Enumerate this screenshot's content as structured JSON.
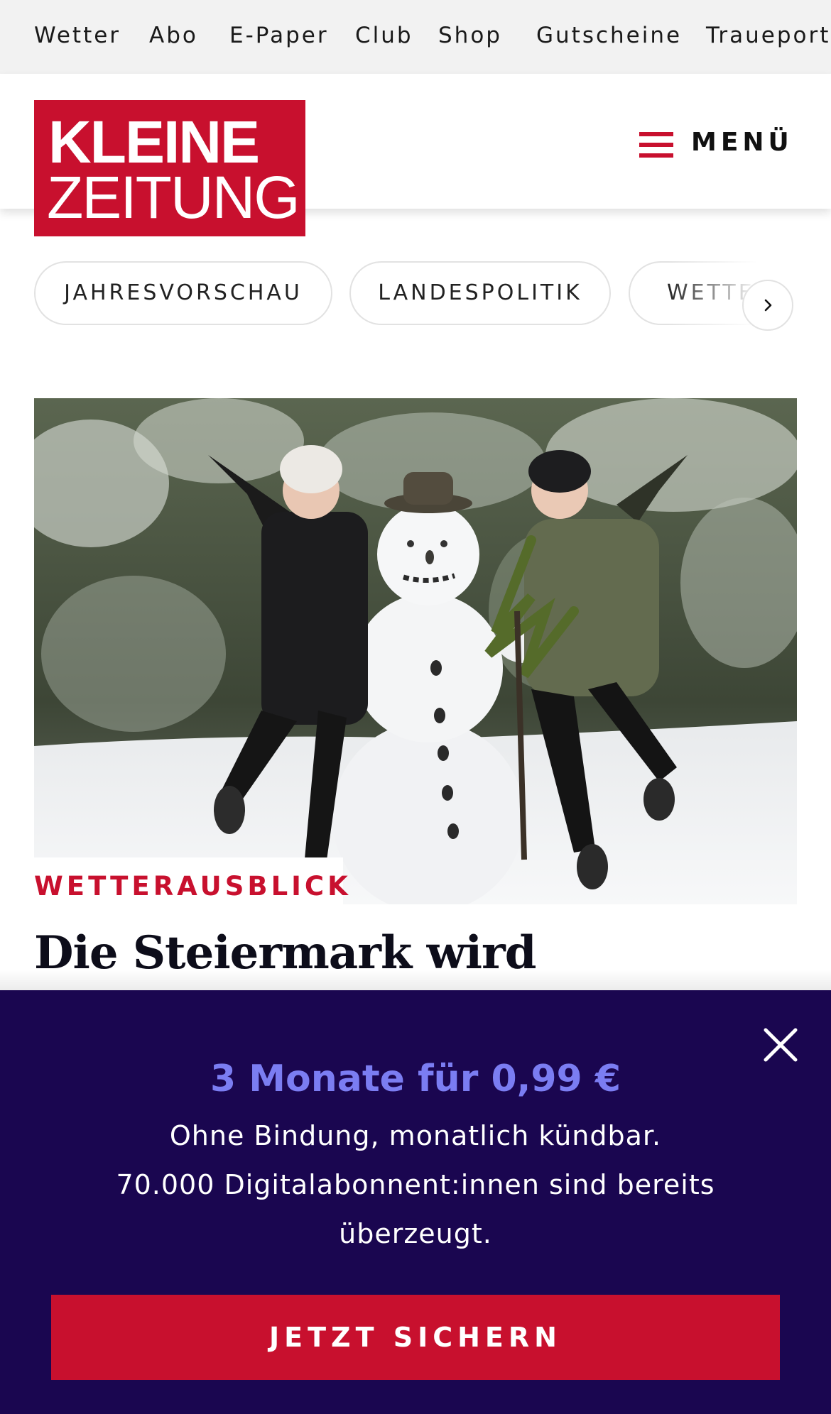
{
  "topnav": {
    "items": [
      {
        "label": "Wetter"
      },
      {
        "label": "Abo"
      },
      {
        "label": "E-Paper"
      },
      {
        "label": "Club"
      },
      {
        "label": "Shop"
      },
      {
        "label": "Gutscheine"
      },
      {
        "label": "Traueportal"
      }
    ]
  },
  "header": {
    "logo_line1": "KLEINE",
    "logo_line2": "ZEITUNG",
    "menu_label": "MENÜ",
    "brand_color": "#c8102e"
  },
  "pills": {
    "items": [
      {
        "label": "JAHRESVORSCHAU"
      },
      {
        "label": "LANDESPOLITIK"
      },
      {
        "label": "WETTER"
      }
    ],
    "next_icon": "chevron-right-icon"
  },
  "article": {
    "kicker": "WETTERAUSBLICK",
    "headline": "Die Steiermark wird",
    "image": "snowman-photo"
  },
  "promo": {
    "title": "3 Monate für 0,99 €",
    "line1": "Ohne Bindung, monatlich kündbar.",
    "line2": "70.000 Digitalabonnent:innen sind bereits",
    "line3": "überzeugt.",
    "cta_label": "JETZT SICHERN",
    "close_icon": "close-icon",
    "background_color": "#1a0650",
    "title_color": "#7b7df2"
  }
}
